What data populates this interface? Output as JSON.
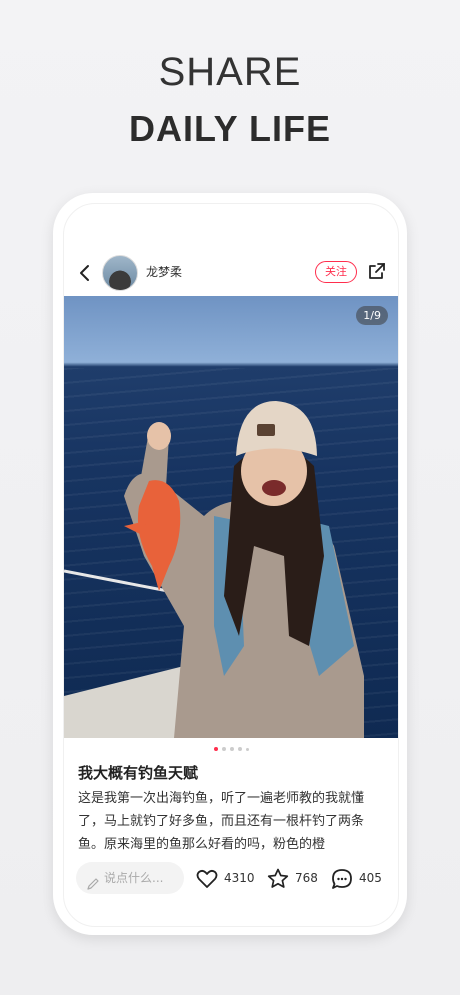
{
  "headline": {
    "line1": "SHARE",
    "line2": "DAILY LIFE"
  },
  "post": {
    "author": "龙梦柔",
    "follow_label": "关注",
    "image_counter": "1/9",
    "title": "我大概有钓鱼天赋",
    "body": "这是我第一次出海钓鱼，听了一遍老师教的我就懂了，马上就钓了好多鱼，而且还有一根杆钓了两条鱼。原来海里的鱼那么好看的吗，粉色的橙",
    "comment_placeholder": "说点什么...",
    "likes": "4310",
    "favorites": "768",
    "comments": "405"
  },
  "colors": {
    "accent": "#ff2e4d"
  },
  "icons": [
    "back-arrow-icon",
    "share-out-icon",
    "pen-icon",
    "heart-icon",
    "star-icon",
    "comment-bubble-icon"
  ]
}
